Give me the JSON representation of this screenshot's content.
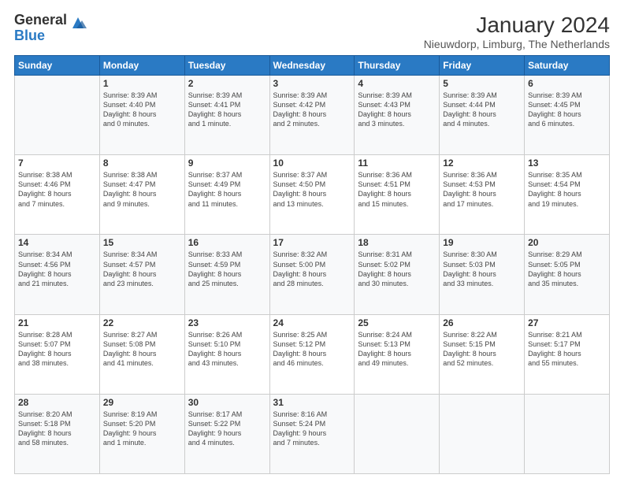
{
  "logo": {
    "general": "General",
    "blue": "Blue"
  },
  "header": {
    "month": "January 2024",
    "location": "Nieuwdorp, Limburg, The Netherlands"
  },
  "weekdays": [
    "Sunday",
    "Monday",
    "Tuesday",
    "Wednesday",
    "Thursday",
    "Friday",
    "Saturday"
  ],
  "weeks": [
    [
      {
        "day": "",
        "info": ""
      },
      {
        "day": "1",
        "info": "Sunrise: 8:39 AM\nSunset: 4:40 PM\nDaylight: 8 hours\nand 0 minutes."
      },
      {
        "day": "2",
        "info": "Sunrise: 8:39 AM\nSunset: 4:41 PM\nDaylight: 8 hours\nand 1 minute."
      },
      {
        "day": "3",
        "info": "Sunrise: 8:39 AM\nSunset: 4:42 PM\nDaylight: 8 hours\nand 2 minutes."
      },
      {
        "day": "4",
        "info": "Sunrise: 8:39 AM\nSunset: 4:43 PM\nDaylight: 8 hours\nand 3 minutes."
      },
      {
        "day": "5",
        "info": "Sunrise: 8:39 AM\nSunset: 4:44 PM\nDaylight: 8 hours\nand 4 minutes."
      },
      {
        "day": "6",
        "info": "Sunrise: 8:39 AM\nSunset: 4:45 PM\nDaylight: 8 hours\nand 6 minutes."
      }
    ],
    [
      {
        "day": "7",
        "info": "Sunrise: 8:38 AM\nSunset: 4:46 PM\nDaylight: 8 hours\nand 7 minutes."
      },
      {
        "day": "8",
        "info": "Sunrise: 8:38 AM\nSunset: 4:47 PM\nDaylight: 8 hours\nand 9 minutes."
      },
      {
        "day": "9",
        "info": "Sunrise: 8:37 AM\nSunset: 4:49 PM\nDaylight: 8 hours\nand 11 minutes."
      },
      {
        "day": "10",
        "info": "Sunrise: 8:37 AM\nSunset: 4:50 PM\nDaylight: 8 hours\nand 13 minutes."
      },
      {
        "day": "11",
        "info": "Sunrise: 8:36 AM\nSunset: 4:51 PM\nDaylight: 8 hours\nand 15 minutes."
      },
      {
        "day": "12",
        "info": "Sunrise: 8:36 AM\nSunset: 4:53 PM\nDaylight: 8 hours\nand 17 minutes."
      },
      {
        "day": "13",
        "info": "Sunrise: 8:35 AM\nSunset: 4:54 PM\nDaylight: 8 hours\nand 19 minutes."
      }
    ],
    [
      {
        "day": "14",
        "info": "Sunrise: 8:34 AM\nSunset: 4:56 PM\nDaylight: 8 hours\nand 21 minutes."
      },
      {
        "day": "15",
        "info": "Sunrise: 8:34 AM\nSunset: 4:57 PM\nDaylight: 8 hours\nand 23 minutes."
      },
      {
        "day": "16",
        "info": "Sunrise: 8:33 AM\nSunset: 4:59 PM\nDaylight: 8 hours\nand 25 minutes."
      },
      {
        "day": "17",
        "info": "Sunrise: 8:32 AM\nSunset: 5:00 PM\nDaylight: 8 hours\nand 28 minutes."
      },
      {
        "day": "18",
        "info": "Sunrise: 8:31 AM\nSunset: 5:02 PM\nDaylight: 8 hours\nand 30 minutes."
      },
      {
        "day": "19",
        "info": "Sunrise: 8:30 AM\nSunset: 5:03 PM\nDaylight: 8 hours\nand 33 minutes."
      },
      {
        "day": "20",
        "info": "Sunrise: 8:29 AM\nSunset: 5:05 PM\nDaylight: 8 hours\nand 35 minutes."
      }
    ],
    [
      {
        "day": "21",
        "info": "Sunrise: 8:28 AM\nSunset: 5:07 PM\nDaylight: 8 hours\nand 38 minutes."
      },
      {
        "day": "22",
        "info": "Sunrise: 8:27 AM\nSunset: 5:08 PM\nDaylight: 8 hours\nand 41 minutes."
      },
      {
        "day": "23",
        "info": "Sunrise: 8:26 AM\nSunset: 5:10 PM\nDaylight: 8 hours\nand 43 minutes."
      },
      {
        "day": "24",
        "info": "Sunrise: 8:25 AM\nSunset: 5:12 PM\nDaylight: 8 hours\nand 46 minutes."
      },
      {
        "day": "25",
        "info": "Sunrise: 8:24 AM\nSunset: 5:13 PM\nDaylight: 8 hours\nand 49 minutes."
      },
      {
        "day": "26",
        "info": "Sunrise: 8:22 AM\nSunset: 5:15 PM\nDaylight: 8 hours\nand 52 minutes."
      },
      {
        "day": "27",
        "info": "Sunrise: 8:21 AM\nSunset: 5:17 PM\nDaylight: 8 hours\nand 55 minutes."
      }
    ],
    [
      {
        "day": "28",
        "info": "Sunrise: 8:20 AM\nSunset: 5:18 PM\nDaylight: 8 hours\nand 58 minutes."
      },
      {
        "day": "29",
        "info": "Sunrise: 8:19 AM\nSunset: 5:20 PM\nDaylight: 9 hours\nand 1 minute."
      },
      {
        "day": "30",
        "info": "Sunrise: 8:17 AM\nSunset: 5:22 PM\nDaylight: 9 hours\nand 4 minutes."
      },
      {
        "day": "31",
        "info": "Sunrise: 8:16 AM\nSunset: 5:24 PM\nDaylight: 9 hours\nand 7 minutes."
      },
      {
        "day": "",
        "info": ""
      },
      {
        "day": "",
        "info": ""
      },
      {
        "day": "",
        "info": ""
      }
    ]
  ]
}
